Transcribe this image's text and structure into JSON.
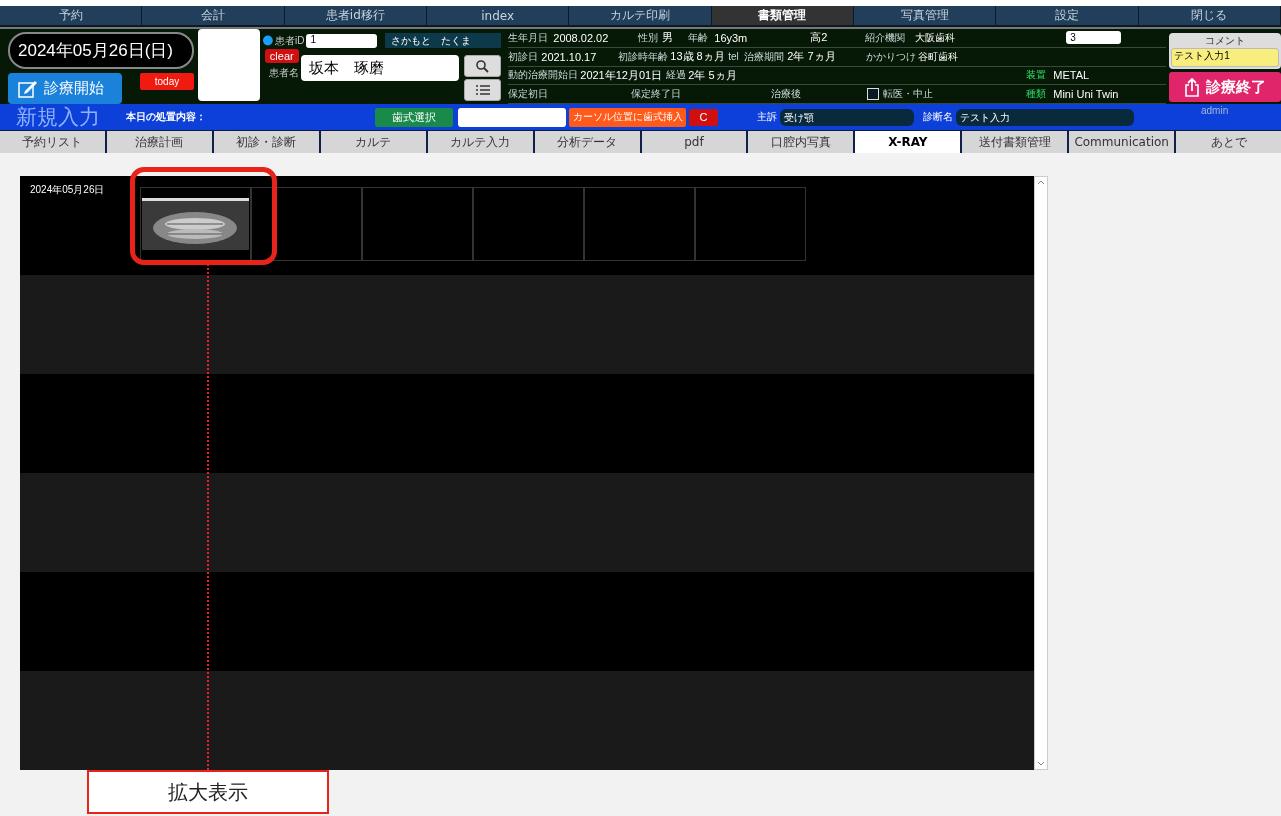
{
  "menu": [
    {
      "label": "予約",
      "selected": false
    },
    {
      "label": "会計",
      "selected": false
    },
    {
      "label": "患者id移行",
      "selected": false
    },
    {
      "label": "index",
      "selected": false
    },
    {
      "label": "カルテ印刷",
      "selected": false
    },
    {
      "label": "書類管理",
      "selected": true
    },
    {
      "label": "写真管理",
      "selected": false
    },
    {
      "label": "設定",
      "selected": false
    },
    {
      "label": "閉じる",
      "selected": false
    }
  ],
  "header": {
    "date": "2024年05月26日(日)",
    "start_button": "診療開始",
    "today_button": "today",
    "patient_id_label": "患者iD",
    "patient_id": "1",
    "kana": "さかもと　たくま",
    "clear_button": "clear",
    "patient_name_label": "患者名",
    "patient_name": "坂本　琢磨",
    "info_rows": [
      [
        {
          "kind": "label",
          "text": "生年月日"
        },
        {
          "kind": "value",
          "text": "2008.02.02"
        },
        {
          "kind": "label",
          "text": "性別"
        },
        {
          "kind": "value",
          "text": "男"
        },
        {
          "kind": "label",
          "text": "年齢"
        },
        {
          "kind": "value",
          "text": "16y3m"
        },
        {
          "kind": "value",
          "text": "高2"
        },
        {
          "kind": "label",
          "text": "紹介機関"
        },
        {
          "kind": "small_value",
          "text": "大阪歯科"
        },
        {
          "kind": "field",
          "text": "3"
        }
      ],
      [
        {
          "kind": "label",
          "text": "初診日"
        },
        {
          "kind": "value",
          "text": "2021.10.17"
        },
        {
          "kind": "label",
          "text": "初診時年齢"
        },
        {
          "kind": "value",
          "text": "13歳 8ヵ月"
        },
        {
          "kind": "label",
          "text": "tel"
        },
        {
          "kind": "label",
          "text": "治療期間"
        },
        {
          "kind": "value",
          "text": "2年 7ヵ月"
        },
        {
          "kind": "label",
          "text": "かかりつけ"
        },
        {
          "kind": "small_value",
          "text": "谷町歯科"
        }
      ],
      [
        {
          "kind": "label",
          "text": "動的治療開始日"
        },
        {
          "kind": "value",
          "text": "2021年12月01日"
        },
        {
          "kind": "label",
          "text": "経過"
        },
        {
          "kind": "value",
          "text": "2年 5ヵ月"
        },
        {
          "kind": "accent_label",
          "text": "装置"
        },
        {
          "kind": "value",
          "text": "METAL"
        }
      ],
      [
        {
          "kind": "label",
          "text": "保定初日"
        },
        {
          "kind": "label",
          "text": "保定終了日"
        },
        {
          "kind": "label",
          "text": "治療後"
        },
        {
          "kind": "checkbox",
          "text": "転医・中止",
          "checked": false
        },
        {
          "kind": "accent_label",
          "text": "種類"
        },
        {
          "kind": "value",
          "text": "Mini Uni Twin"
        }
      ]
    ],
    "comment_label": "コメント",
    "comment": "テスト入力1",
    "end_button": "診療終了"
  },
  "entry_bar": {
    "title": "新規入力",
    "treatment_label": "本日の処置内容：",
    "tooth_select_button": "歯式選択",
    "insert_button": "カーソル位置に歯式挿入",
    "clear_button": "C",
    "complaint_label": "主訴",
    "complaint": "受け顎",
    "diagnosis_label": "診断名",
    "diagnosis": "テスト入力",
    "user": "admin"
  },
  "tabs": [
    {
      "label": "予約リスト",
      "selected": false
    },
    {
      "label": "治療計画",
      "selected": false
    },
    {
      "label": "初診・診断",
      "selected": false
    },
    {
      "label": "カルテ",
      "selected": false
    },
    {
      "label": "カルテ入力",
      "selected": false
    },
    {
      "label": "分析データ",
      "selected": false
    },
    {
      "label": "pdf",
      "selected": false
    },
    {
      "label": "口腔内写真",
      "selected": false
    },
    {
      "label": "X-RAY",
      "selected": true
    },
    {
      "label": "送付書類管理",
      "selected": false
    },
    {
      "label": "Communication",
      "selected": false
    },
    {
      "label": "あとで",
      "selected": false
    }
  ],
  "xray": {
    "sessions": [
      {
        "date": "2024年05月26日",
        "images": [
          {
            "kind": "panoramic"
          },
          {
            "kind": "empty"
          },
          {
            "kind": "empty"
          },
          {
            "kind": "empty"
          },
          {
            "kind": "empty"
          },
          {
            "kind": "empty"
          }
        ]
      }
    ]
  },
  "annotation": {
    "callout": "拡大表示"
  }
}
